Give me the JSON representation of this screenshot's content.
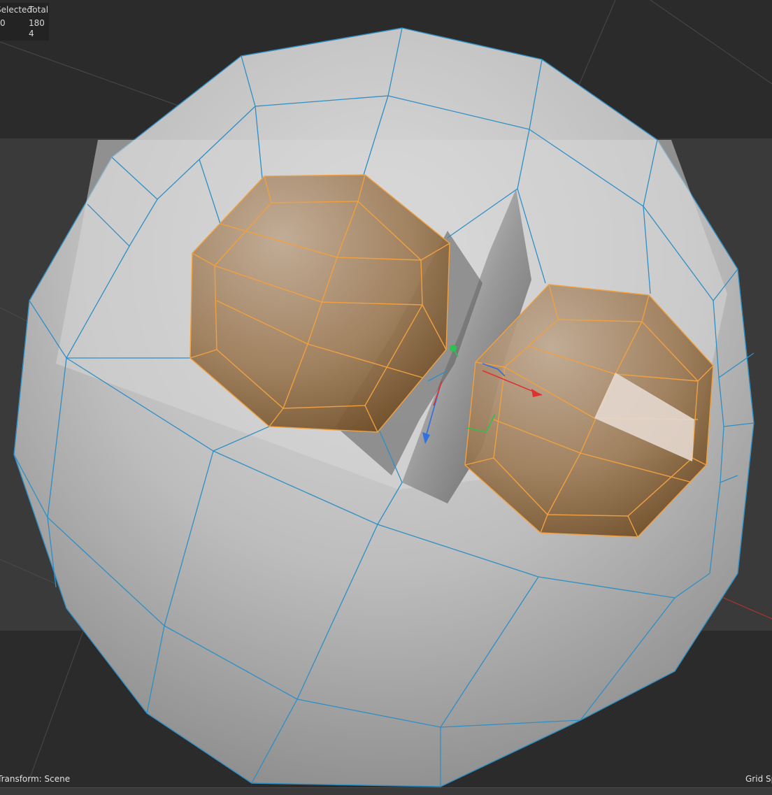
{
  "stats": {
    "header_selected": "Selected",
    "header_total": "Total",
    "row1": {
      "selected": "0",
      "total": "180"
    },
    "row2": {
      "selected": "",
      "total": "4"
    }
  },
  "status": {
    "transform": "Transform: Scene",
    "grid": "Grid Spacing"
  },
  "colors": {
    "background": "#2b2b2b",
    "mesh_surface": "#c9c9c9",
    "wire_edge": "#2e8fc4",
    "selected_face": "#9b7a55",
    "selected_edge": "#f0a040",
    "highlight_face": "#e6d8cf",
    "axis_x": "#e03030",
    "axis_y": "#30c050",
    "axis_z": "#3070e0"
  }
}
